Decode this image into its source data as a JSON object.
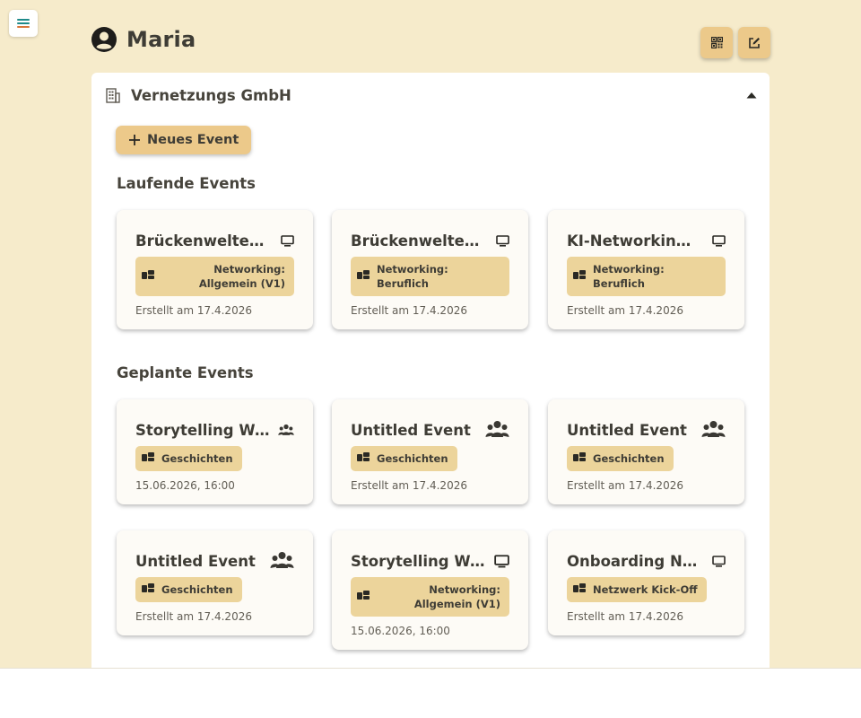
{
  "header": {
    "title": "Maria"
  },
  "organization": {
    "name": "Vernetzungs GmbH"
  },
  "actions": {
    "new_event": "Neues Event"
  },
  "sections": {
    "running": {
      "title": "Laufende Events",
      "cards": [
        {
          "title": "Brückenwelten ...",
          "icon": "monitor-icon",
          "tag": "Networking: Allgemein (V1)",
          "meta": "Erstellt am 17.4.2026"
        },
        {
          "title": "Brückenwelten ...",
          "icon": "monitor-icon",
          "tag": "Networking: Beruflich",
          "meta": "Erstellt am 17.4.2026"
        },
        {
          "title": "KI-Networking F...",
          "icon": "monitor-icon",
          "tag": "Networking: Beruflich",
          "meta": "Erstellt am 17.4.2026"
        }
      ]
    },
    "planned": {
      "title": "Geplante Events",
      "cards": [
        {
          "title": "Storytelling Wor...",
          "icon": "users-icon",
          "tag": "Geschichten",
          "meta": "15.06.2026, 16:00"
        },
        {
          "title": "Untitled Event",
          "icon": "users-icon",
          "tag": "Geschichten",
          "meta": "Erstellt am 17.4.2026"
        },
        {
          "title": "Untitled Event",
          "icon": "users-icon",
          "tag": "Geschichten",
          "meta": "Erstellt am 17.4.2026"
        },
        {
          "title": "Untitled Event",
          "icon": "users-icon",
          "tag": "Geschichten",
          "meta": "Erstellt am 17.4.2026"
        },
        {
          "title": "Storytelling Wor...",
          "icon": "monitor-icon",
          "tag": "Networking: Allgemein (V1)",
          "meta": "15.06.2026, 16:00"
        },
        {
          "title": "Onboarding Neu...",
          "icon": "monitor-icon",
          "tag": "Netzwerk Kick-Off",
          "meta": "Erstellt am 17.4.2026"
        }
      ]
    }
  },
  "colors": {
    "background": "#f6ebcb",
    "accent": "#ecc98a",
    "tag": "#ecd49b",
    "menu_icon_top": "#1f8a8a",
    "menu_icon_bottom": "#d9763a"
  }
}
